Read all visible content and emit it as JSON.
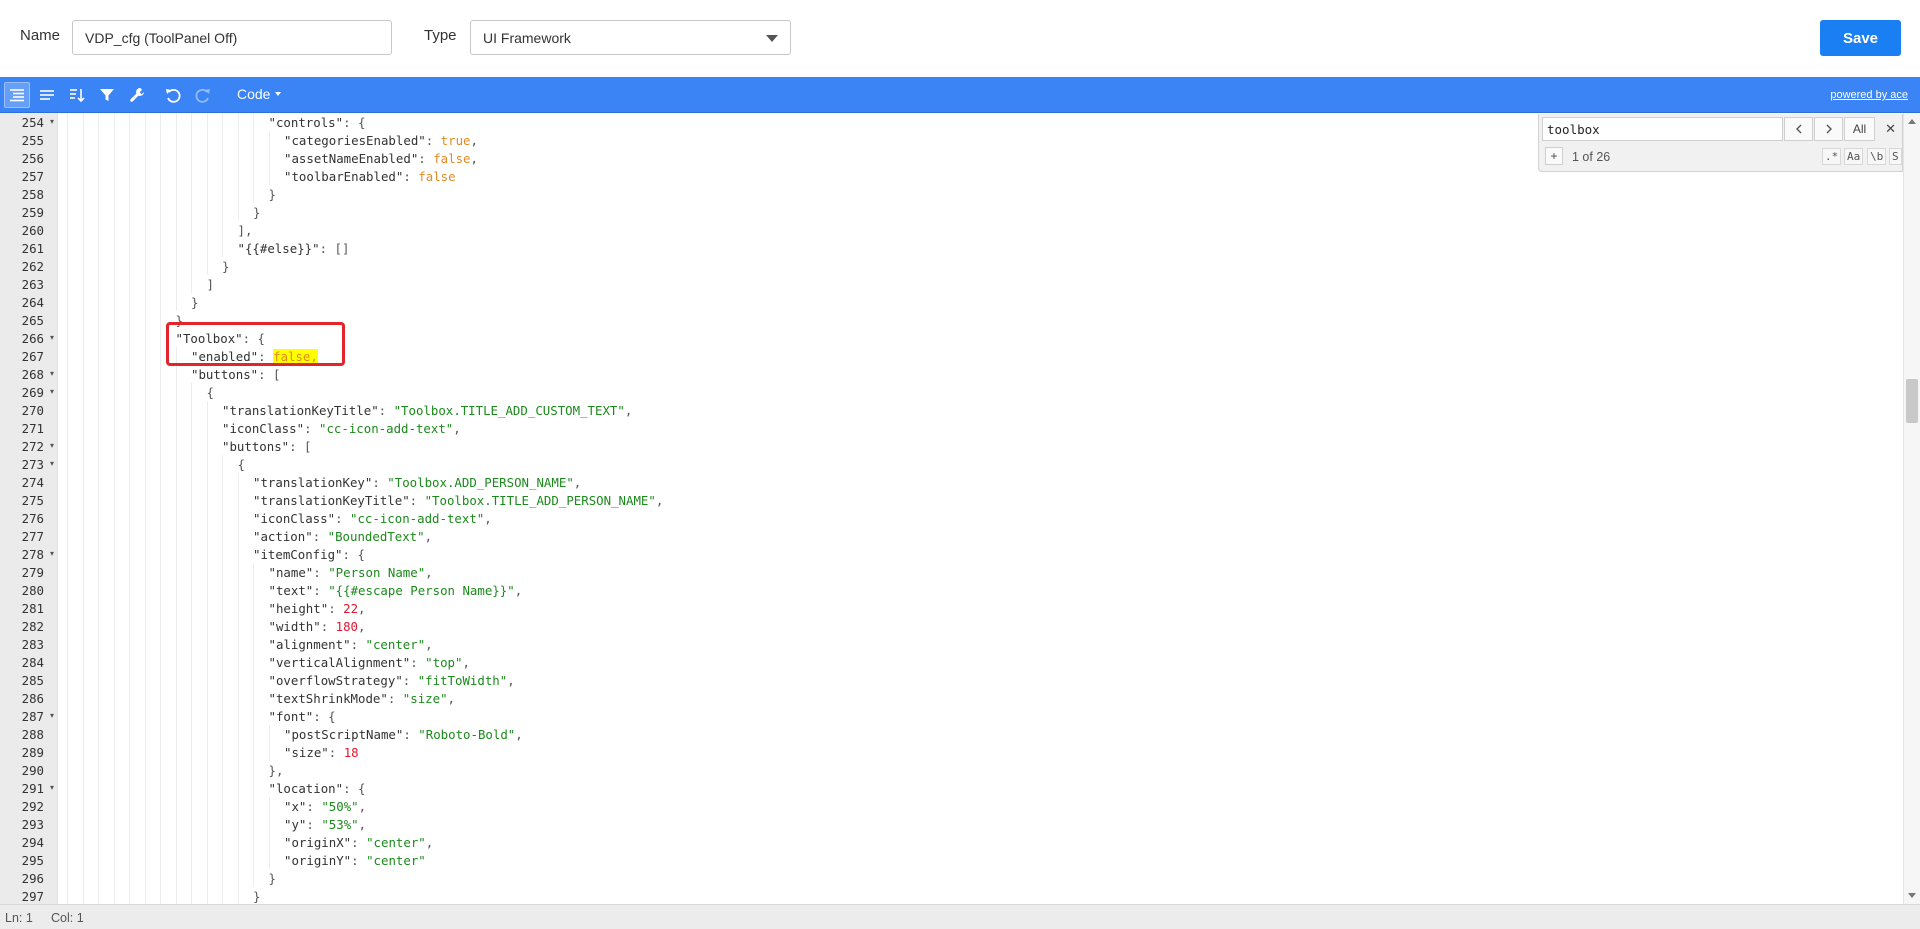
{
  "form": {
    "name_label": "Name",
    "name_value": "VDP_cfg (ToolPanel Off)",
    "type_label": "Type",
    "type_value": "UI Framework",
    "save_label": "Save"
  },
  "toolbar": {
    "mode_label": "Code",
    "powered_by": "powered by ace",
    "icons": [
      "format-icon",
      "compact-icon",
      "sort-icon",
      "filter-icon",
      "repair-icon",
      "undo-icon",
      "redo-icon"
    ]
  },
  "search": {
    "query": "toolbox",
    "all_label": "All",
    "count": "1 of 26",
    "regex_label": ".*",
    "case_label": "Aa",
    "word_label": "\\b",
    "selection_label": "S"
  },
  "status": {
    "ln": "Ln: 1",
    "col": "Col: 1"
  },
  "colors": {
    "toolbar": "#3b84f6",
    "save": "#1a7ff2",
    "string": "#1c8a1c",
    "number": "#e3162d",
    "boolean": "#e58a22",
    "highlight": "#ffff00",
    "annotation": "#e5232b"
  },
  "lines": [
    {
      "n": "254",
      "fold": true,
      "indent": 13,
      "tokens": [
        [
          "k",
          "\"controls\""
        ],
        [
          "p",
          ": {"
        ]
      ]
    },
    {
      "n": "255",
      "fold": false,
      "indent": 14,
      "tokens": [
        [
          "k",
          "\"categoriesEnabled\""
        ],
        [
          "p",
          ": "
        ],
        [
          "b",
          "true"
        ],
        [
          "p",
          ","
        ]
      ]
    },
    {
      "n": "256",
      "fold": false,
      "indent": 14,
      "tokens": [
        [
          "k",
          "\"assetNameEnabled\""
        ],
        [
          "p",
          ": "
        ],
        [
          "b",
          "false"
        ],
        [
          "p",
          ","
        ]
      ]
    },
    {
      "n": "257",
      "fold": false,
      "indent": 14,
      "tokens": [
        [
          "k",
          "\"toolbarEnabled\""
        ],
        [
          "p",
          ": "
        ],
        [
          "b",
          "false"
        ]
      ]
    },
    {
      "n": "258",
      "fold": false,
      "indent": 13,
      "tokens": [
        [
          "p",
          "}"
        ]
      ]
    },
    {
      "n": "259",
      "fold": false,
      "indent": 12,
      "tokens": [
        [
          "p",
          "}"
        ]
      ]
    },
    {
      "n": "260",
      "fold": false,
      "indent": 11,
      "tokens": [
        [
          "p",
          "],"
        ]
      ]
    },
    {
      "n": "261",
      "fold": false,
      "indent": 11,
      "tokens": [
        [
          "k",
          "\"{{#else}}\""
        ],
        [
          "p",
          ": []"
        ]
      ]
    },
    {
      "n": "262",
      "fold": false,
      "indent": 10,
      "tokens": [
        [
          "p",
          "}"
        ]
      ]
    },
    {
      "n": "263",
      "fold": false,
      "indent": 9,
      "tokens": [
        [
          "p",
          "]"
        ]
      ]
    },
    {
      "n": "264",
      "fold": false,
      "indent": 8,
      "tokens": [
        [
          "p",
          "}"
        ]
      ]
    },
    {
      "n": "265",
      "fold": false,
      "indent": 7,
      "tokens": [
        [
          "p",
          "}"
        ]
      ]
    },
    {
      "n": "266",
      "fold": true,
      "indent": 7,
      "tokens": [
        [
          "k",
          "\"Toolbox\""
        ],
        [
          "p",
          ": {"
        ]
      ]
    },
    {
      "n": "267",
      "fold": false,
      "indent": 8,
      "tokens": [
        [
          "k",
          "\"enabled\""
        ],
        [
          "p",
          ": "
        ],
        [
          "h",
          "false,"
        ]
      ]
    },
    {
      "n": "268",
      "fold": true,
      "indent": 8,
      "tokens": [
        [
          "k",
          "\"buttons\""
        ],
        [
          "p",
          ": ["
        ]
      ]
    },
    {
      "n": "269",
      "fold": true,
      "indent": 9,
      "tokens": [
        [
          "p",
          "{"
        ]
      ]
    },
    {
      "n": "270",
      "fold": false,
      "indent": 10,
      "tokens": [
        [
          "k",
          "\"translationKeyTitle\""
        ],
        [
          "p",
          ": "
        ],
        [
          "s",
          "\"Toolbox.TITLE_ADD_CUSTOM_TEXT\""
        ],
        [
          "p",
          ","
        ]
      ]
    },
    {
      "n": "271",
      "fold": false,
      "indent": 10,
      "tokens": [
        [
          "k",
          "\"iconClass\""
        ],
        [
          "p",
          ": "
        ],
        [
          "s",
          "\"cc-icon-add-text\""
        ],
        [
          "p",
          ","
        ]
      ]
    },
    {
      "n": "272",
      "fold": true,
      "indent": 10,
      "tokens": [
        [
          "k",
          "\"buttons\""
        ],
        [
          "p",
          ": ["
        ]
      ]
    },
    {
      "n": "273",
      "fold": true,
      "indent": 11,
      "tokens": [
        [
          "p",
          "{"
        ]
      ]
    },
    {
      "n": "274",
      "fold": false,
      "indent": 12,
      "tokens": [
        [
          "k",
          "\"translationKey\""
        ],
        [
          "p",
          ": "
        ],
        [
          "s",
          "\"Toolbox.ADD_PERSON_NAME\""
        ],
        [
          "p",
          ","
        ]
      ]
    },
    {
      "n": "275",
      "fold": false,
      "indent": 12,
      "tokens": [
        [
          "k",
          "\"translationKeyTitle\""
        ],
        [
          "p",
          ": "
        ],
        [
          "s",
          "\"Toolbox.TITLE_ADD_PERSON_NAME\""
        ],
        [
          "p",
          ","
        ]
      ]
    },
    {
      "n": "276",
      "fold": false,
      "indent": 12,
      "tokens": [
        [
          "k",
          "\"iconClass\""
        ],
        [
          "p",
          ": "
        ],
        [
          "s",
          "\"cc-icon-add-text\""
        ],
        [
          "p",
          ","
        ]
      ]
    },
    {
      "n": "277",
      "fold": false,
      "indent": 12,
      "tokens": [
        [
          "k",
          "\"action\""
        ],
        [
          "p",
          ": "
        ],
        [
          "s",
          "\"BoundedText\""
        ],
        [
          "p",
          ","
        ]
      ]
    },
    {
      "n": "278",
      "fold": true,
      "indent": 12,
      "tokens": [
        [
          "k",
          "\"itemConfig\""
        ],
        [
          "p",
          ": {"
        ]
      ]
    },
    {
      "n": "279",
      "fold": false,
      "indent": 13,
      "tokens": [
        [
          "k",
          "\"name\""
        ],
        [
          "p",
          ": "
        ],
        [
          "s",
          "\"Person Name\""
        ],
        [
          "p",
          ","
        ]
      ]
    },
    {
      "n": "280",
      "fold": false,
      "indent": 13,
      "tokens": [
        [
          "k",
          "\"text\""
        ],
        [
          "p",
          ": "
        ],
        [
          "s",
          "\"{{#escape Person Name}}\""
        ],
        [
          "p",
          ","
        ]
      ]
    },
    {
      "n": "281",
      "fold": false,
      "indent": 13,
      "tokens": [
        [
          "k",
          "\"height\""
        ],
        [
          "p",
          ": "
        ],
        [
          "n",
          "22"
        ],
        [
          "p",
          ","
        ]
      ]
    },
    {
      "n": "282",
      "fold": false,
      "indent": 13,
      "tokens": [
        [
          "k",
          "\"width\""
        ],
        [
          "p",
          ": "
        ],
        [
          "n",
          "180"
        ],
        [
          "p",
          ","
        ]
      ]
    },
    {
      "n": "283",
      "fold": false,
      "indent": 13,
      "tokens": [
        [
          "k",
          "\"alignment\""
        ],
        [
          "p",
          ": "
        ],
        [
          "s",
          "\"center\""
        ],
        [
          "p",
          ","
        ]
      ]
    },
    {
      "n": "284",
      "fold": false,
      "indent": 13,
      "tokens": [
        [
          "k",
          "\"verticalAlignment\""
        ],
        [
          "p",
          ": "
        ],
        [
          "s",
          "\"top\""
        ],
        [
          "p",
          ","
        ]
      ]
    },
    {
      "n": "285",
      "fold": false,
      "indent": 13,
      "tokens": [
        [
          "k",
          "\"overflowStrategy\""
        ],
        [
          "p",
          ": "
        ],
        [
          "s",
          "\"fitToWidth\""
        ],
        [
          "p",
          ","
        ]
      ]
    },
    {
      "n": "286",
      "fold": false,
      "indent": 13,
      "tokens": [
        [
          "k",
          "\"textShrinkMode\""
        ],
        [
          "p",
          ": "
        ],
        [
          "s",
          "\"size\""
        ],
        [
          "p",
          ","
        ]
      ]
    },
    {
      "n": "287",
      "fold": true,
      "indent": 13,
      "tokens": [
        [
          "k",
          "\"font\""
        ],
        [
          "p",
          ": {"
        ]
      ]
    },
    {
      "n": "288",
      "fold": false,
      "indent": 14,
      "tokens": [
        [
          "k",
          "\"postScriptName\""
        ],
        [
          "p",
          ": "
        ],
        [
          "s",
          "\"Roboto-Bold\""
        ],
        [
          "p",
          ","
        ]
      ]
    },
    {
      "n": "289",
      "fold": false,
      "indent": 14,
      "tokens": [
        [
          "k",
          "\"size\""
        ],
        [
          "p",
          ": "
        ],
        [
          "n",
          "18"
        ]
      ]
    },
    {
      "n": "290",
      "fold": false,
      "indent": 13,
      "tokens": [
        [
          "p",
          "},"
        ]
      ]
    },
    {
      "n": "291",
      "fold": true,
      "indent": 13,
      "tokens": [
        [
          "k",
          "\"location\""
        ],
        [
          "p",
          ": {"
        ]
      ]
    },
    {
      "n": "292",
      "fold": false,
      "indent": 14,
      "tokens": [
        [
          "k",
          "\"x\""
        ],
        [
          "p",
          ": "
        ],
        [
          "s",
          "\"50%\""
        ],
        [
          "p",
          ","
        ]
      ]
    },
    {
      "n": "293",
      "fold": false,
      "indent": 14,
      "tokens": [
        [
          "k",
          "\"y\""
        ],
        [
          "p",
          ": "
        ],
        [
          "s",
          "\"53%\""
        ],
        [
          "p",
          ","
        ]
      ]
    },
    {
      "n": "294",
      "fold": false,
      "indent": 14,
      "tokens": [
        [
          "k",
          "\"originX\""
        ],
        [
          "p",
          ": "
        ],
        [
          "s",
          "\"center\""
        ],
        [
          "p",
          ","
        ]
      ]
    },
    {
      "n": "295",
      "fold": false,
      "indent": 14,
      "tokens": [
        [
          "k",
          "\"originY\""
        ],
        [
          "p",
          ": "
        ],
        [
          "s",
          "\"center\""
        ]
      ]
    },
    {
      "n": "296",
      "fold": false,
      "indent": 13,
      "tokens": [
        [
          "p",
          "}"
        ]
      ]
    },
    {
      "n": "297",
      "fold": false,
      "indent": 12,
      "tokens": [
        [
          "p",
          "}"
        ]
      ]
    }
  ]
}
